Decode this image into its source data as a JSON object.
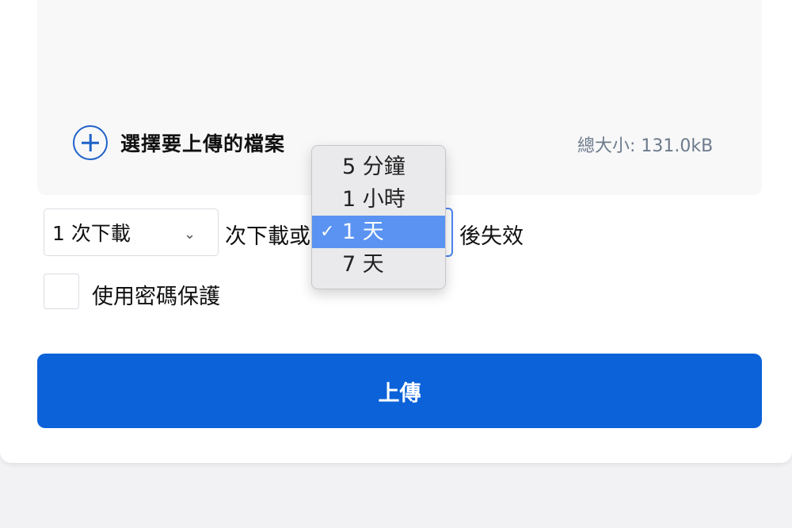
{
  "upload": {
    "add_files_label": "選擇要上傳的檔案",
    "total_size": "總大小: 131.0kB"
  },
  "options": {
    "downloads_selected": "1 次下載",
    "middle_text": "次下載或",
    "after_text": "後失效",
    "expire_options": [
      {
        "label": "5 分鐘",
        "selected": false
      },
      {
        "label": "1 小時",
        "selected": false
      },
      {
        "label": "1 天",
        "selected": true
      },
      {
        "label": "7 天",
        "selected": false
      }
    ],
    "password_label": "使用密碼保護"
  },
  "button": {
    "upload_label": "上傳"
  },
  "colors": {
    "primary": "#0b62d9",
    "highlight": "#5a93f2",
    "icon": "#1f62c9"
  }
}
